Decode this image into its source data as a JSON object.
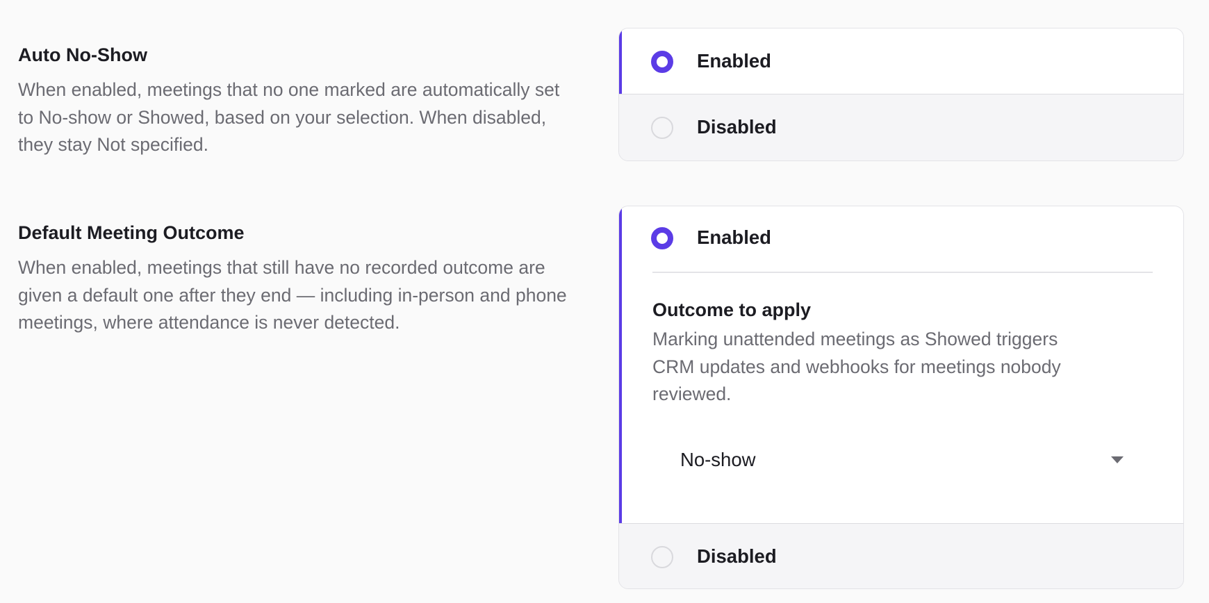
{
  "auto_no_show": {
    "title": "Auto No-Show",
    "description": "When enabled, meetings that no one marked are automatically set to No-show or Showed, based on your selection. When disabled, they stay Not specified.",
    "options": [
      {
        "label": "Enabled",
        "selected": true
      },
      {
        "label": "Disabled",
        "selected": false
      }
    ]
  },
  "default_outcome": {
    "title": "Default Meeting Outcome",
    "description": "When enabled, meetings that still have no recorded outcome are given a default one after they end — including in-person and phone meetings, where attendance is never detected.",
    "options": [
      {
        "label": "Enabled",
        "selected": true
      },
      {
        "label": "Disabled",
        "selected": false
      }
    ],
    "outcome_title": "Outcome to apply",
    "outcome_description": "Marking unattended meetings as Showed triggers CRM updates and webhooks for meetings nobody reviewed.",
    "outcome_value": "No-show"
  },
  "colors": {
    "accent": "#5b3ce6",
    "muted_text": "#6b6b72",
    "card_bg": "#f5f5f7"
  }
}
